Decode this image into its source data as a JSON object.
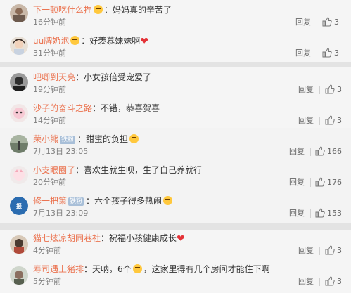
{
  "ui": {
    "reply_label": "回复",
    "vip_label": "铁粉"
  },
  "colors": {
    "username": "#eb7350",
    "time": "#808080",
    "panel_bg": "#f5f5f5",
    "page_bg": "#e3e3e3"
  },
  "icons": [
    "emoji-smile-icon",
    "heart-icon",
    "thumbs-up-icon",
    "avatar"
  ],
  "panels": [
    {
      "comments": [
        {
          "user": "下一顿吃什么捏",
          "text": "妈妈真的辛苦了",
          "prefix_emoji": true,
          "suffix": "",
          "time": "16分钟前",
          "likes": "3"
        },
        {
          "user": "uu牌奶泡",
          "text": "好羡慕妹妹啊",
          "prefix_emoji": true,
          "suffix": "heart",
          "time": "31分钟前",
          "likes": "3"
        }
      ]
    },
    {
      "comments": [
        {
          "user": "吧唧到天亮",
          "text": "小女孩倍受宠爱了",
          "time": "19分钟前",
          "likes": "3"
        },
        {
          "user": "沙子的奋斗之路",
          "text": "不错，恭喜贺喜",
          "time": "14分钟前",
          "likes": "3"
        }
      ]
    },
    {
      "comments": [
        {
          "user": "荣小熊",
          "vip": true,
          "text": "甜蜜的负担",
          "suffix": "emoji",
          "time": "7月13日 23:05",
          "likes": "166"
        },
        {
          "user": "小支眼圈了",
          "text": "喜欢生就生呗，生了自己养就行",
          "time": "20分钟前",
          "likes": "176"
        },
        {
          "user": "修一把箫",
          "vip": true,
          "text": "六个孩子得多热闹",
          "suffix": "emoji",
          "time": "7月13日 23:09",
          "likes": "153"
        }
      ]
    },
    {
      "comments": [
        {
          "user": "猫七炫凉胡同巷社",
          "text": "祝福小孩健康成长",
          "suffix": "heart",
          "time": "4分钟前",
          "likes": "3"
        },
        {
          "user": "寿司遇上猪排",
          "text": "天呐，6个",
          "suffix": "emoji",
          "text2": "，这家里得有几个房间才能住下啊",
          "time": "5分钟前",
          "likes": "3"
        }
      ]
    }
  ]
}
